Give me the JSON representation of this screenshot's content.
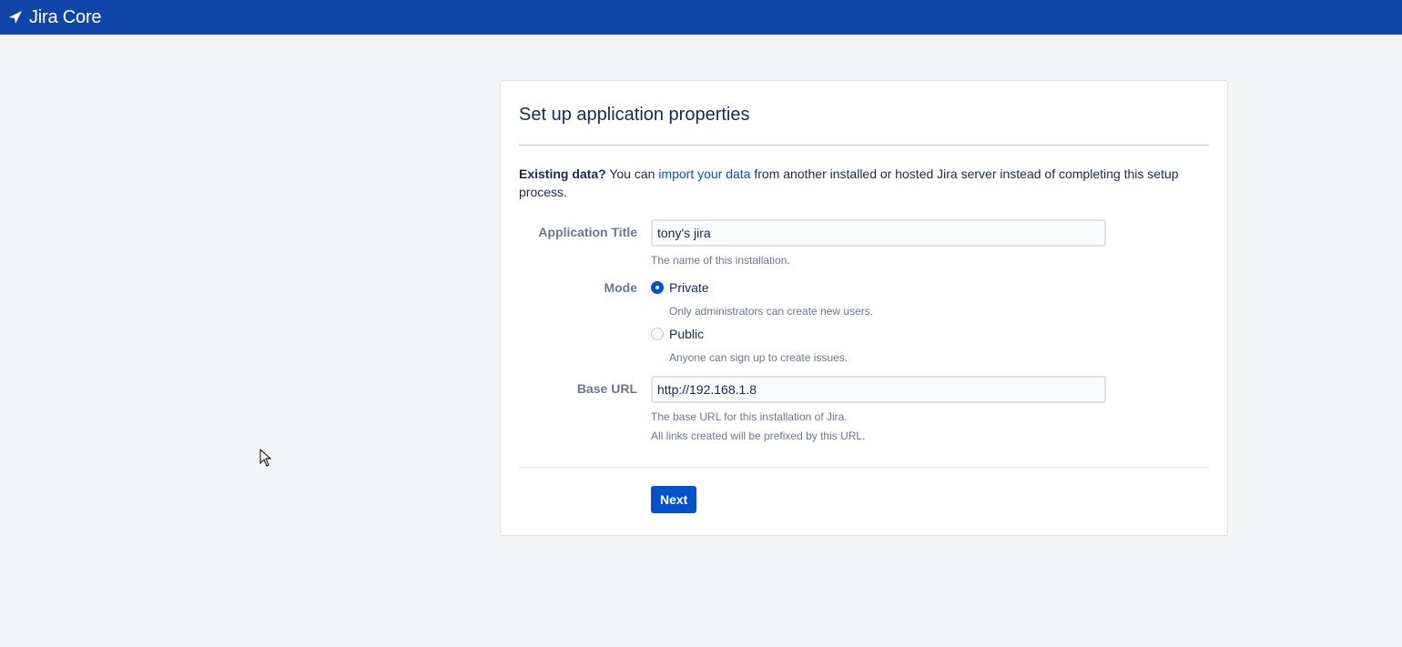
{
  "header": {
    "logo_text": "Jira Core",
    "logo_icon": "jira-arrow-icon",
    "bg_color": "#0f46a8"
  },
  "panel": {
    "title": "Set up application properties",
    "intro": {
      "bold": "Existing data?",
      "before_link": " You can ",
      "link_text": "import your data",
      "after_link": " from another installed or hosted Jira server instead of completing this setup process."
    },
    "application_title": {
      "label": "Application Title",
      "value": "tony's jira",
      "help": "The name of this installation."
    },
    "mode": {
      "label": "Mode",
      "options": [
        {
          "label": "Private",
          "help": "Only administrators can create new users.",
          "selected": true
        },
        {
          "label": "Public",
          "help": "Anyone can sign up to create issues.",
          "selected": false
        }
      ]
    },
    "base_url": {
      "label": "Base URL",
      "value": "http://192.168.1.8",
      "help_line1": "The base URL for this installation of Jira.",
      "help_line2": "All links created will be prefixed by this URL."
    },
    "next_label": "Next"
  },
  "colors": {
    "accent": "#0052cc",
    "page_bg": "#f4f5f7"
  }
}
